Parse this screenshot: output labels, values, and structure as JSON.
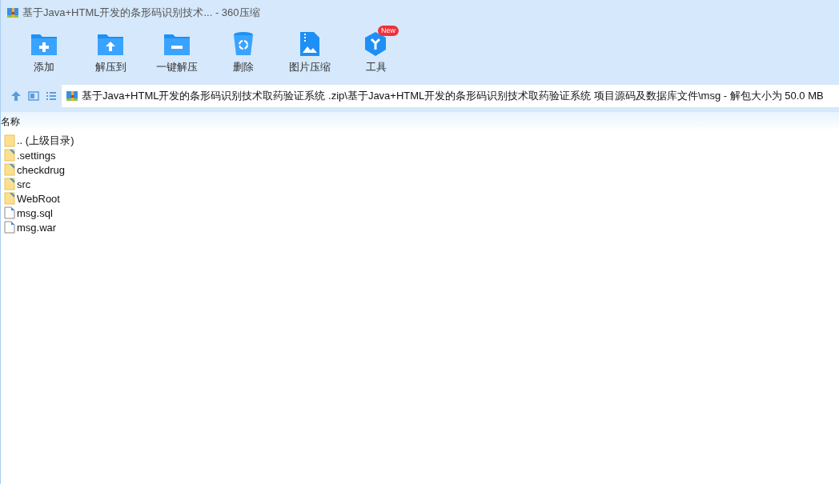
{
  "window": {
    "title": "基于Java+HTML开发的条形码识别技术... - 360压缩"
  },
  "toolbar": [
    {
      "kind": "add",
      "label": "添加"
    },
    {
      "kind": "extract_to",
      "label": "解压到"
    },
    {
      "kind": "extract_one",
      "label": "一键解压"
    },
    {
      "kind": "delete",
      "label": "删除"
    },
    {
      "kind": "image",
      "label": "图片压缩"
    },
    {
      "kind": "tools",
      "label": "工具",
      "badge": "New"
    }
  ],
  "address": {
    "path": "基于Java+HTML开发的条形码识别技术取药验证系统 .zip\\基于Java+HTML开发的条形码识别技术取药验证系统 项目源码及数据库文件\\msg - 解包大小为 50.0 MB"
  },
  "table": {
    "columns": [
      "名称"
    ],
    "rows": [
      {
        "kind": "parent",
        "name": ".. (上级目录)"
      },
      {
        "kind": "folder",
        "name": ".settings"
      },
      {
        "kind": "folder",
        "name": "checkdrug"
      },
      {
        "kind": "folder",
        "name": "src"
      },
      {
        "kind": "folder",
        "name": "WebRoot"
      },
      {
        "kind": "file",
        "name": "msg.sql"
      },
      {
        "kind": "file",
        "name": "msg.war"
      }
    ]
  }
}
